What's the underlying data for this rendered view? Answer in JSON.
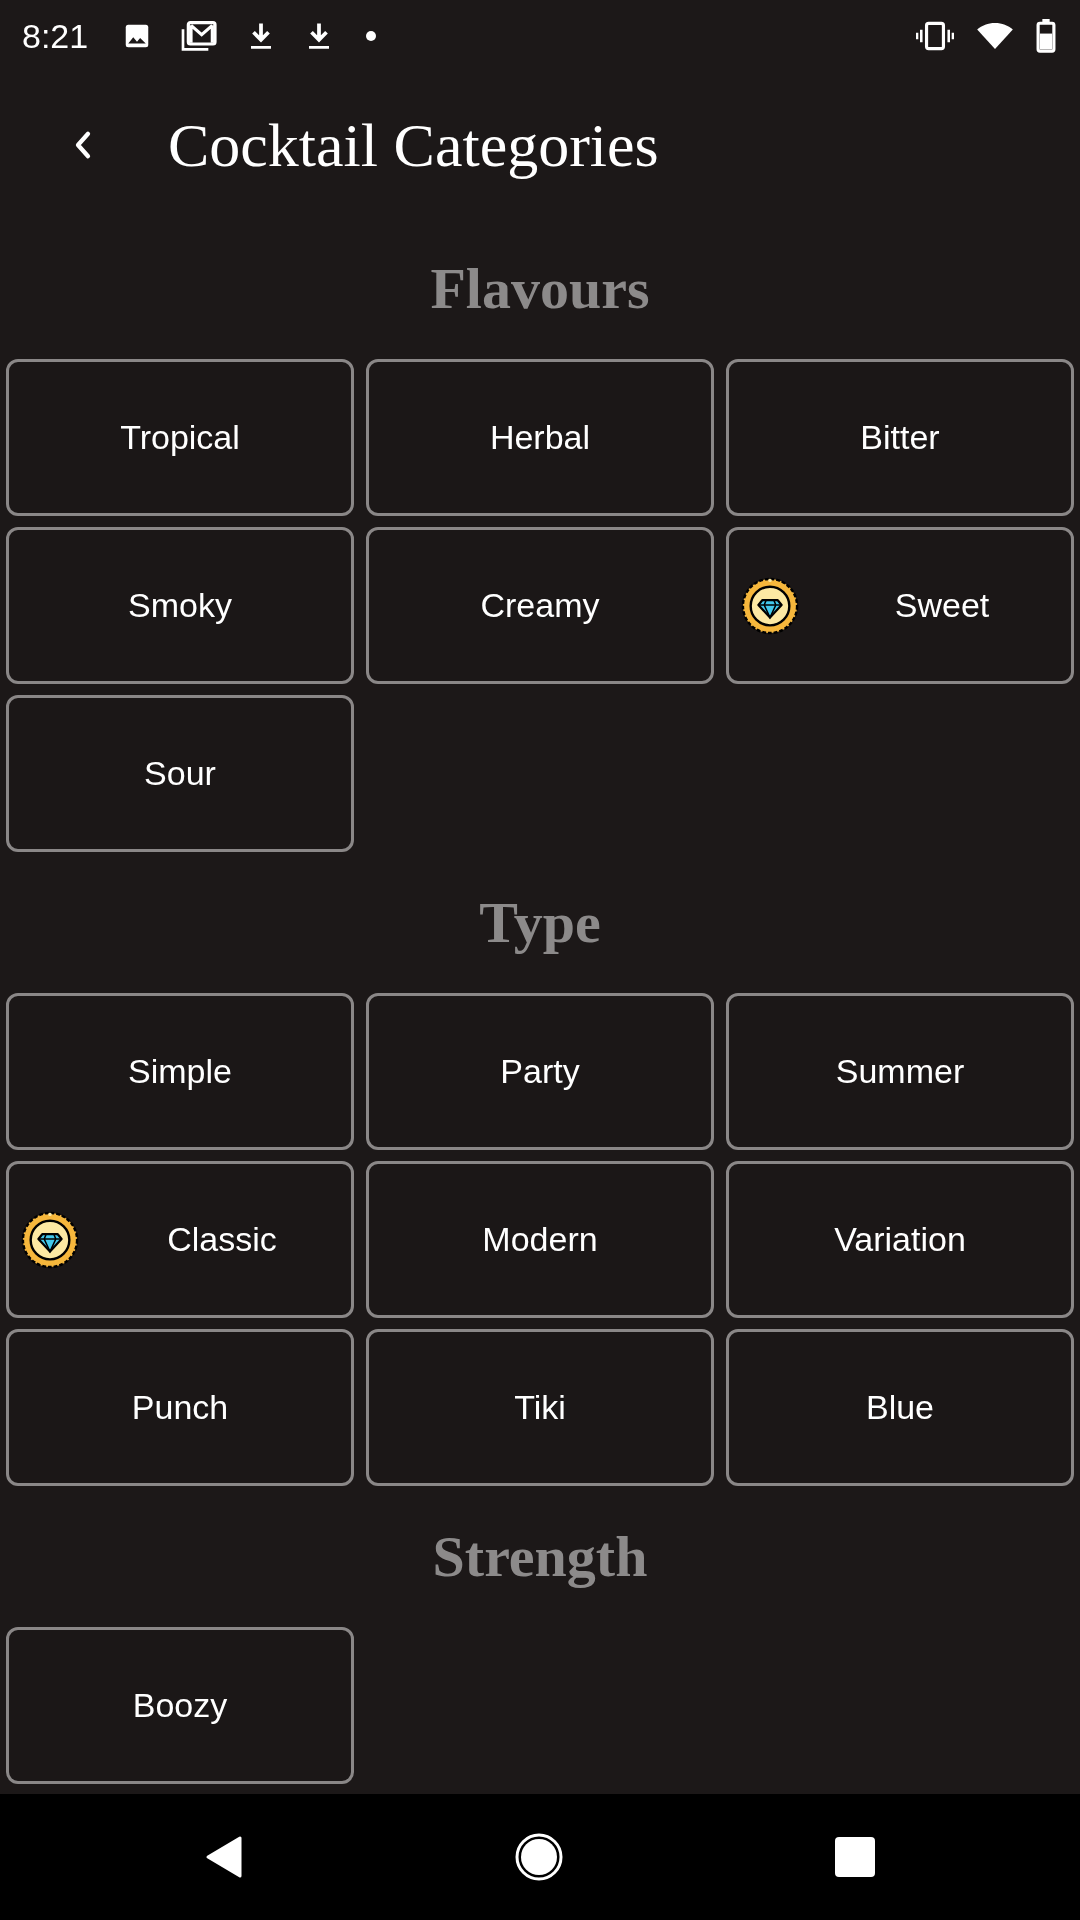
{
  "status_bar": {
    "time": "8:21"
  },
  "header": {
    "title": "Cocktail Categories"
  },
  "sections": [
    {
      "title": "Flavours",
      "items": [
        {
          "label": "Tropical",
          "badge": false
        },
        {
          "label": "Herbal",
          "badge": false
        },
        {
          "label": "Bitter",
          "badge": false
        },
        {
          "label": "Smoky",
          "badge": false
        },
        {
          "label": "Creamy",
          "badge": false
        },
        {
          "label": "Sweet",
          "badge": true
        },
        {
          "label": "Sour",
          "badge": false
        }
      ]
    },
    {
      "title": "Type",
      "items": [
        {
          "label": "Simple",
          "badge": false
        },
        {
          "label": "Party",
          "badge": false
        },
        {
          "label": "Summer",
          "badge": false
        },
        {
          "label": "Classic",
          "badge": true
        },
        {
          "label": "Modern",
          "badge": false
        },
        {
          "label": "Variation",
          "badge": false
        },
        {
          "label": "Punch",
          "badge": false
        },
        {
          "label": "Tiki",
          "badge": false
        },
        {
          "label": "Blue",
          "badge": false
        }
      ]
    },
    {
      "title": "Strength",
      "items": [
        {
          "label": "Boozy",
          "badge": false
        }
      ]
    }
  ]
}
